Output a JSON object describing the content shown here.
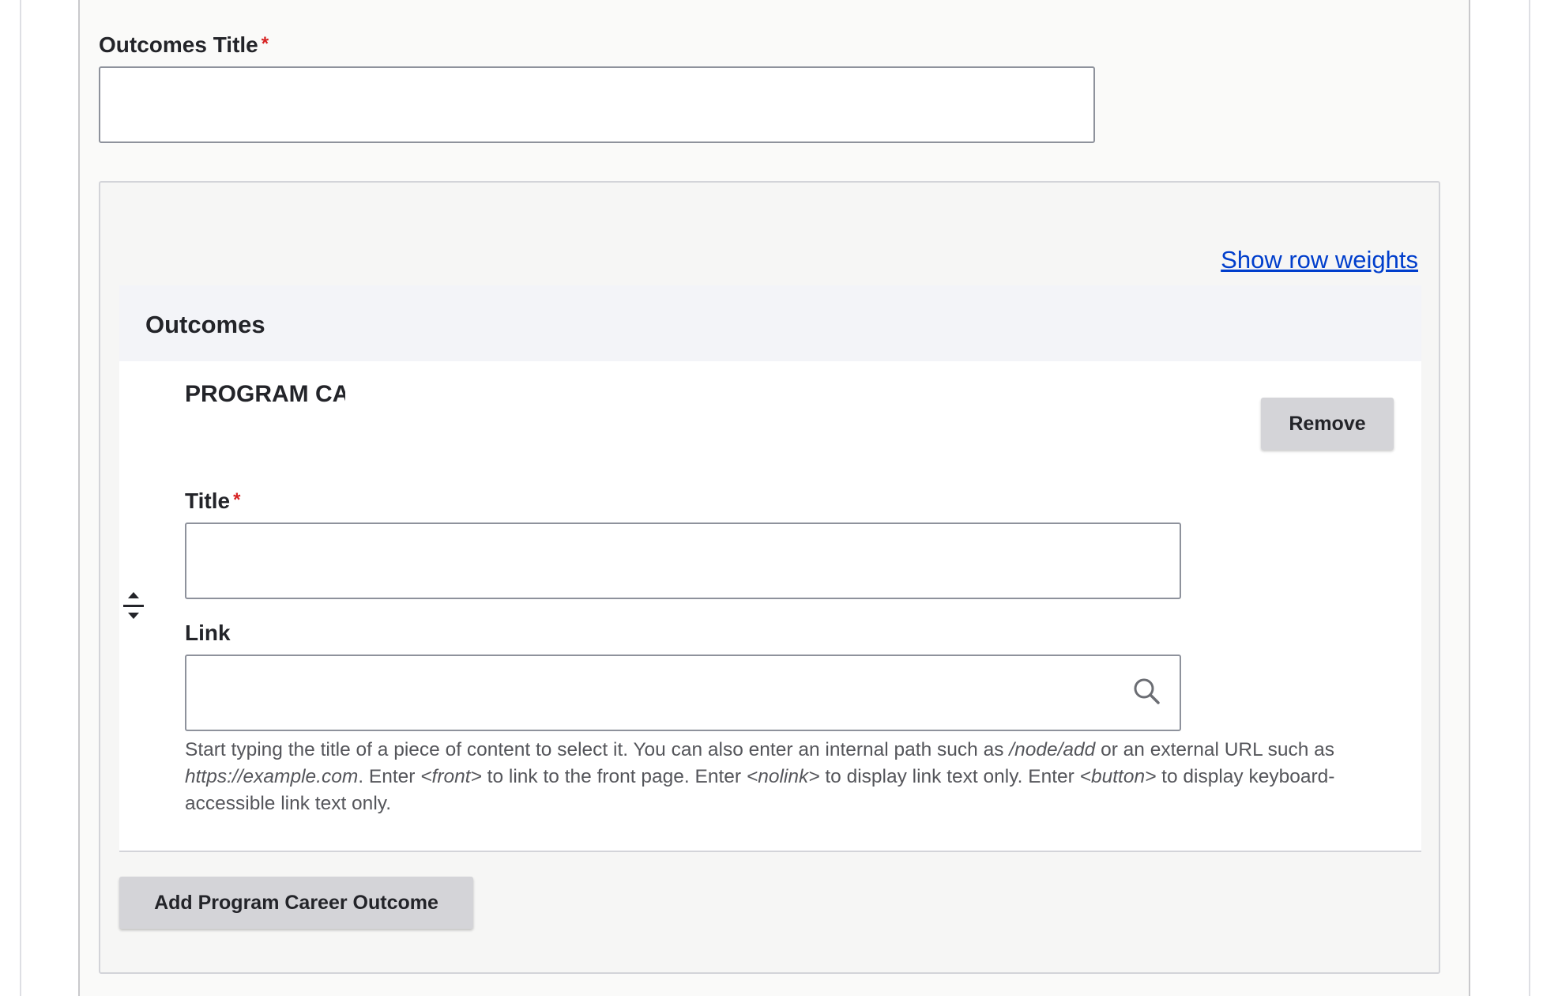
{
  "outcomes_title": {
    "label": "Outcomes Title",
    "required_marker": "*",
    "value": ""
  },
  "widget": {
    "show_row_weights_label": "Show row weights",
    "table_header": "Outcomes",
    "rows": [
      {
        "paragraph_type": "PROGRAM CA",
        "remove_label": "Remove",
        "title_field": {
          "label": "Title",
          "required_marker": "*",
          "value": ""
        },
        "link_field": {
          "label": "Link",
          "value": "",
          "icon": "search-icon",
          "help_parts": [
            "Start typing the title of a piece of content to select it. You can also enter an internal path such as ",
            "/node/add",
            " or an external URL such as ",
            "https://example.com",
            ". Enter ",
            "<front>",
            " to link to the front page. Enter ",
            "<nolink>",
            " to display link text only. Enter ",
            "<button>",
            " to display keyboard-accessible link text only."
          ]
        }
      }
    ],
    "add_button_label": "Add Program Career Outcome"
  },
  "colors": {
    "link": "#003ecc",
    "required": "#d72222",
    "button_bg": "#d4d4d8",
    "header_bg": "#f3f4f8"
  }
}
